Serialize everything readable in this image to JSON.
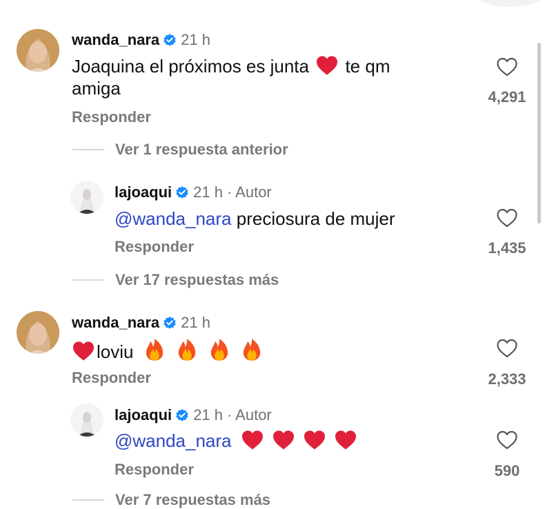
{
  "icons": {
    "like": "heart-outline-icon",
    "verified": "verified-badge-icon",
    "heart_emoji": "red-heart-emoji",
    "fire_emoji": "fire-emoji"
  },
  "colors": {
    "mention": "#2f47c4",
    "verified": "#1a8cff",
    "secondary_text": "#6f6f6f",
    "heart_emoji": "#e0203a"
  },
  "comments": [
    {
      "username": "wanda_nara",
      "verified": true,
      "time": "21 h",
      "text": "Joaquina el próximos es junta",
      "text_after_emoji": "te qm amiga",
      "reply_label": "Responder",
      "likes": "4,291"
    },
    {
      "username": "lajoaqui",
      "verified": true,
      "time": "21 h",
      "author_tag": "· Autor",
      "mention": "@wanda_nara",
      "text": "preciosura de mujer",
      "reply_label": "Responder",
      "likes": "1,435"
    },
    {
      "username": "wanda_nara",
      "verified": true,
      "time": "21 h",
      "text": "loviu",
      "reply_label": "Responder",
      "likes": "2,333"
    },
    {
      "username": "lajoaqui",
      "verified": true,
      "time": "21 h",
      "author_tag": "· Autor",
      "mention": "@wanda_nara",
      "reply_label": "Responder",
      "likes": "590"
    }
  ],
  "view_replies": [
    {
      "label": "Ver 1 respuesta anterior"
    },
    {
      "label": "Ver 17 respuestas más"
    },
    {
      "label": "Ver 7 respuestas más"
    }
  ]
}
